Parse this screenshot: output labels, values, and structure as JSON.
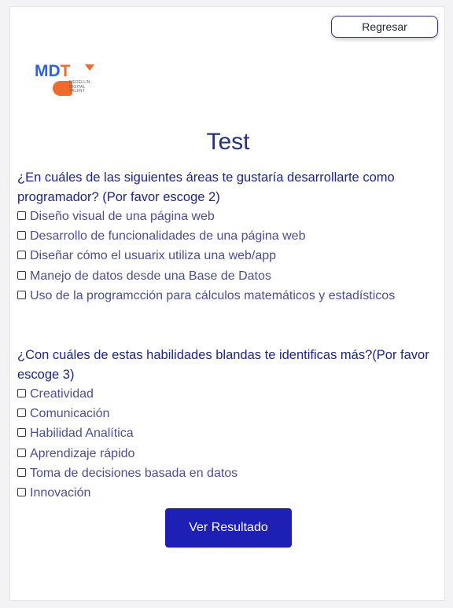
{
  "header": {
    "back_label": "Regresar"
  },
  "logo": {
    "text_m": "M",
    "text_d": "D",
    "text_t": "T",
    "sub_line1": "MEDELLIN",
    "sub_line2": "DIGITAL",
    "sub_line3": "TALENT"
  },
  "page": {
    "title": "Test"
  },
  "question1": {
    "text": "¿En cuáles de las siguientes áreas te gustaría desarrollarte como programador? (Por favor escoge 2)",
    "options": [
      {
        "label": "Diseño visual de una página web",
        "checked": false
      },
      {
        "label": "Desarrollo de funcionalidades de una página web",
        "checked": false
      },
      {
        "label": "Diseñar cómo el usuarix utiliza una web/app",
        "checked": false
      },
      {
        "label": "Manejo de datos desde una Base de Datos",
        "checked": false
      },
      {
        "label": "Uso de la programcción para cálculos matemáticos y estadísticos",
        "checked": false
      }
    ]
  },
  "question2": {
    "text": "¿Con cuáles de estas habilidades blandas te identificas más?(Por favor escoge 3)",
    "options": [
      {
        "label": "Creatividad",
        "checked": false
      },
      {
        "label": "Comunicación",
        "checked": false
      },
      {
        "label": "Habilidad Analítica",
        "checked": false
      },
      {
        "label": "Aprendizaje rápido",
        "checked": false
      },
      {
        "label": "Toma de decisiones basada en datos",
        "checked": false
      },
      {
        "label": "Innovación",
        "checked": false
      }
    ]
  },
  "actions": {
    "submit_label": "Ver Resultado"
  },
  "colors": {
    "primary": "#1e20b5",
    "heading": "#25307e",
    "question": "#1d2585",
    "option": "#4b4f8f",
    "logo_blue": "#2e63e0",
    "logo_orange": "#ef6a2d"
  }
}
